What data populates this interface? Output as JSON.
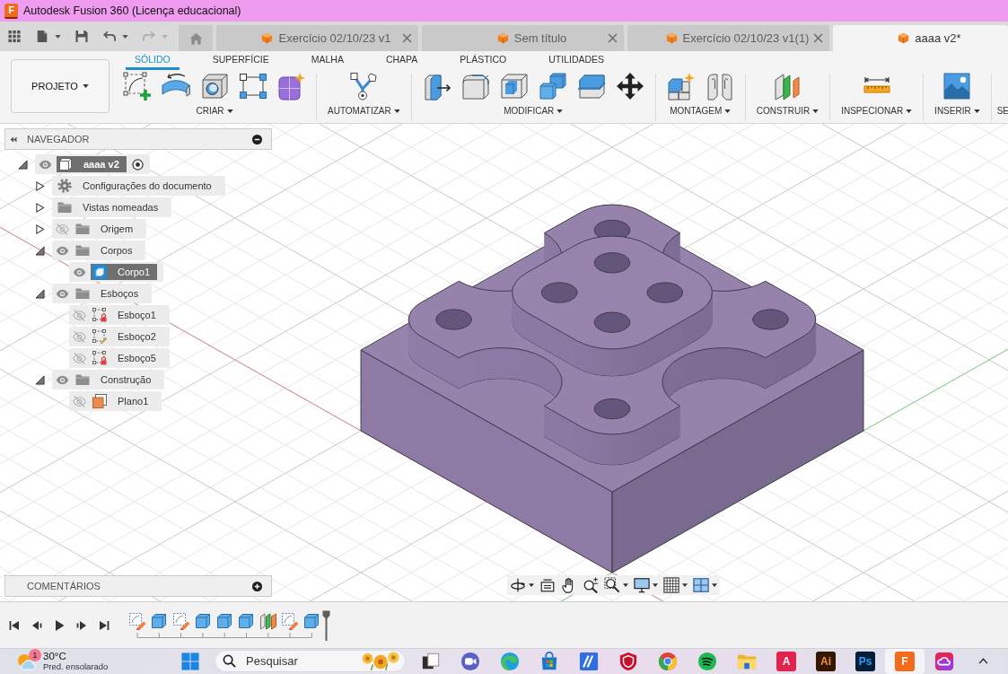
{
  "window": {
    "app_icon": "F",
    "title": "Autodesk Fusion 360 (Licença educacional)"
  },
  "quick_access": [
    {
      "kind": "apps",
      "dropdown": false,
      "disabled": false
    },
    {
      "kind": "file",
      "dropdown": true,
      "disabled": false
    },
    {
      "kind": "save",
      "dropdown": false,
      "disabled": false
    },
    {
      "kind": "undo",
      "dropdown": true,
      "disabled": false
    },
    {
      "kind": "redo",
      "dropdown": true,
      "disabled": true
    }
  ],
  "document_tabs": [
    {
      "kind": "home",
      "selected": false
    },
    {
      "kind": "document",
      "title": "Exercício 02/10/23 v1",
      "selected": false
    },
    {
      "kind": "document",
      "title": "Sem título",
      "selected": false
    },
    {
      "kind": "document",
      "title": "Exercício 02/10/23 v1(1)",
      "selected": false
    },
    {
      "kind": "document",
      "title": "aaaa v2*",
      "selected": true
    }
  ],
  "toolbar": {
    "project": "PROJETO",
    "workspaces": [
      {
        "label": "SÓLIDO",
        "selected": true
      },
      {
        "label": "SUPERFÍCIE",
        "selected": false
      },
      {
        "label": "MALHA",
        "selected": false
      },
      {
        "label": "CHAPA",
        "selected": false
      },
      {
        "label": "PLÁSTICO",
        "selected": false
      },
      {
        "label": "UTILIDADES",
        "selected": false
      }
    ],
    "panels": [
      {
        "label": "CRIAR",
        "tools": [
          {
            "kind": "sketch"
          },
          {
            "kind": "revolve"
          },
          {
            "kind": "hole"
          },
          {
            "kind": "pattern"
          },
          {
            "kind": "form"
          }
        ]
      },
      {
        "label": "AUTOMATIZAR",
        "tools": [
          {
            "kind": "automate"
          }
        ]
      },
      {
        "label": "MODIFICAR",
        "tools": [
          {
            "kind": "presspull"
          },
          {
            "kind": "fillet"
          },
          {
            "kind": "shell"
          },
          {
            "kind": "combine"
          },
          {
            "kind": "split"
          },
          {
            "kind": "move"
          }
        ]
      },
      {
        "label": "MONTAGEM",
        "tools": [
          {
            "kind": "component"
          },
          {
            "kind": "joint"
          }
        ]
      },
      {
        "label": "CONSTRUIR",
        "tools": [
          {
            "kind": "plane"
          }
        ]
      },
      {
        "label": "INSPECIONAR",
        "tools": [
          {
            "kind": "measure"
          }
        ]
      },
      {
        "label": "INSERIR",
        "tools": [
          {
            "kind": "image"
          }
        ]
      },
      {
        "label": "SE"
      }
    ]
  },
  "navigator": {
    "title": "NAVEGADOR",
    "tree": [
      {
        "label": "aaaa v2",
        "kind": "component",
        "expanded": true,
        "visible": true,
        "selected": true,
        "children": [
          {
            "label": "Configurações do documento",
            "kind": "settings",
            "expanded": false,
            "selected": false
          },
          {
            "label": "Vistas nomeadas",
            "kind": "folder",
            "expanded": false,
            "selected": false
          },
          {
            "label": "Origem",
            "kind": "folder",
            "expanded": false,
            "visible": false,
            "selected": false
          },
          {
            "label": "Corpos",
            "kind": "folder",
            "expanded": true,
            "visible": true,
            "selected": false,
            "children": [
              {
                "label": "Corpo1",
                "kind": "body",
                "visible": true,
                "selected": true
              }
            ]
          },
          {
            "label": "Esboços",
            "kind": "folder",
            "expanded": true,
            "visible": true,
            "selected": false,
            "children": [
              {
                "label": "Esboço1",
                "kind": "sketch",
                "locked": true,
                "visible": false,
                "selected": false
              },
              {
                "label": "Esboço2",
                "kind": "sketch",
                "locked": false,
                "visible": false,
                "selected": false
              },
              {
                "label": "Esboço5",
                "kind": "sketch",
                "locked": true,
                "visible": false,
                "selected": false
              }
            ]
          },
          {
            "label": "Construção",
            "kind": "folder",
            "expanded": true,
            "visible": true,
            "selected": false,
            "children": [
              {
                "label": "Plano1",
                "kind": "plane",
                "visible": false,
                "selected": false
              }
            ]
          }
        ]
      }
    ]
  },
  "comments": {
    "title": "COMENTÁRIOS"
  },
  "timeline": {
    "features": [
      {
        "kind": "sketch"
      },
      {
        "kind": "extrude"
      },
      {
        "kind": "sketch"
      },
      {
        "kind": "extrude"
      },
      {
        "kind": "extrude"
      },
      {
        "kind": "extrude"
      },
      {
        "kind": "plane"
      },
      {
        "kind": "sketch"
      },
      {
        "kind": "extrude"
      }
    ]
  },
  "taskbar": {
    "weather": {
      "badge": "1",
      "temperature": "30°C",
      "condition": "Pred. ensolarado"
    },
    "search": {
      "placeholder": "Pesquisar"
    },
    "apps": [
      {
        "kind": "stack",
        "active": false
      },
      {
        "kind": "camera",
        "active": false
      },
      {
        "kind": "swirl",
        "active": false
      },
      {
        "kind": "bag",
        "active": false
      },
      {
        "kind": "slashes",
        "active": false
      },
      {
        "kind": "shield",
        "active": false
      },
      {
        "kind": "tricolor",
        "active": false
      },
      {
        "kind": "arcs",
        "active": false
      },
      {
        "kind": "folder",
        "active": false
      },
      {
        "kind": "tile",
        "label": "A",
        "color": "#e2234d",
        "active": false
      },
      {
        "kind": "tile",
        "label": "Ai",
        "color": "#331800",
        "active": false
      },
      {
        "kind": "tile",
        "label": "Ps",
        "color": "#001e36",
        "active": false
      },
      {
        "kind": "tile",
        "label": "F",
        "color": "#f26b1d",
        "active": true
      },
      {
        "kind": "cloud",
        "active": false
      }
    ]
  }
}
